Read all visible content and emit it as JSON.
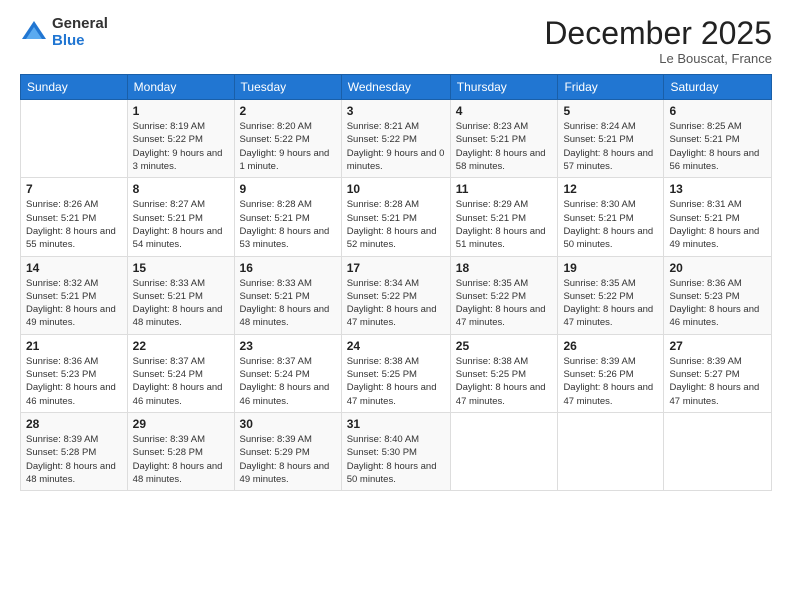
{
  "logo": {
    "general": "General",
    "blue": "Blue"
  },
  "title": "December 2025",
  "subtitle": "Le Bouscat, France",
  "days_of_week": [
    "Sunday",
    "Monday",
    "Tuesday",
    "Wednesday",
    "Thursday",
    "Friday",
    "Saturday"
  ],
  "weeks": [
    [
      {
        "day": "",
        "sunrise": "",
        "sunset": "",
        "daylight": ""
      },
      {
        "day": "1",
        "sunrise": "Sunrise: 8:19 AM",
        "sunset": "Sunset: 5:22 PM",
        "daylight": "Daylight: 9 hours and 3 minutes."
      },
      {
        "day": "2",
        "sunrise": "Sunrise: 8:20 AM",
        "sunset": "Sunset: 5:22 PM",
        "daylight": "Daylight: 9 hours and 1 minute."
      },
      {
        "day": "3",
        "sunrise": "Sunrise: 8:21 AM",
        "sunset": "Sunset: 5:22 PM",
        "daylight": "Daylight: 9 hours and 0 minutes."
      },
      {
        "day": "4",
        "sunrise": "Sunrise: 8:23 AM",
        "sunset": "Sunset: 5:21 PM",
        "daylight": "Daylight: 8 hours and 58 minutes."
      },
      {
        "day": "5",
        "sunrise": "Sunrise: 8:24 AM",
        "sunset": "Sunset: 5:21 PM",
        "daylight": "Daylight: 8 hours and 57 minutes."
      },
      {
        "day": "6",
        "sunrise": "Sunrise: 8:25 AM",
        "sunset": "Sunset: 5:21 PM",
        "daylight": "Daylight: 8 hours and 56 minutes."
      }
    ],
    [
      {
        "day": "7",
        "sunrise": "Sunrise: 8:26 AM",
        "sunset": "Sunset: 5:21 PM",
        "daylight": "Daylight: 8 hours and 55 minutes."
      },
      {
        "day": "8",
        "sunrise": "Sunrise: 8:27 AM",
        "sunset": "Sunset: 5:21 PM",
        "daylight": "Daylight: 8 hours and 54 minutes."
      },
      {
        "day": "9",
        "sunrise": "Sunrise: 8:28 AM",
        "sunset": "Sunset: 5:21 PM",
        "daylight": "Daylight: 8 hours and 53 minutes."
      },
      {
        "day": "10",
        "sunrise": "Sunrise: 8:28 AM",
        "sunset": "Sunset: 5:21 PM",
        "daylight": "Daylight: 8 hours and 52 minutes."
      },
      {
        "day": "11",
        "sunrise": "Sunrise: 8:29 AM",
        "sunset": "Sunset: 5:21 PM",
        "daylight": "Daylight: 8 hours and 51 minutes."
      },
      {
        "day": "12",
        "sunrise": "Sunrise: 8:30 AM",
        "sunset": "Sunset: 5:21 PM",
        "daylight": "Daylight: 8 hours and 50 minutes."
      },
      {
        "day": "13",
        "sunrise": "Sunrise: 8:31 AM",
        "sunset": "Sunset: 5:21 PM",
        "daylight": "Daylight: 8 hours and 49 minutes."
      }
    ],
    [
      {
        "day": "14",
        "sunrise": "Sunrise: 8:32 AM",
        "sunset": "Sunset: 5:21 PM",
        "daylight": "Daylight: 8 hours and 49 minutes."
      },
      {
        "day": "15",
        "sunrise": "Sunrise: 8:33 AM",
        "sunset": "Sunset: 5:21 PM",
        "daylight": "Daylight: 8 hours and 48 minutes."
      },
      {
        "day": "16",
        "sunrise": "Sunrise: 8:33 AM",
        "sunset": "Sunset: 5:21 PM",
        "daylight": "Daylight: 8 hours and 48 minutes."
      },
      {
        "day": "17",
        "sunrise": "Sunrise: 8:34 AM",
        "sunset": "Sunset: 5:22 PM",
        "daylight": "Daylight: 8 hours and 47 minutes."
      },
      {
        "day": "18",
        "sunrise": "Sunrise: 8:35 AM",
        "sunset": "Sunset: 5:22 PM",
        "daylight": "Daylight: 8 hours and 47 minutes."
      },
      {
        "day": "19",
        "sunrise": "Sunrise: 8:35 AM",
        "sunset": "Sunset: 5:22 PM",
        "daylight": "Daylight: 8 hours and 47 minutes."
      },
      {
        "day": "20",
        "sunrise": "Sunrise: 8:36 AM",
        "sunset": "Sunset: 5:23 PM",
        "daylight": "Daylight: 8 hours and 46 minutes."
      }
    ],
    [
      {
        "day": "21",
        "sunrise": "Sunrise: 8:36 AM",
        "sunset": "Sunset: 5:23 PM",
        "daylight": "Daylight: 8 hours and 46 minutes."
      },
      {
        "day": "22",
        "sunrise": "Sunrise: 8:37 AM",
        "sunset": "Sunset: 5:24 PM",
        "daylight": "Daylight: 8 hours and 46 minutes."
      },
      {
        "day": "23",
        "sunrise": "Sunrise: 8:37 AM",
        "sunset": "Sunset: 5:24 PM",
        "daylight": "Daylight: 8 hours and 46 minutes."
      },
      {
        "day": "24",
        "sunrise": "Sunrise: 8:38 AM",
        "sunset": "Sunset: 5:25 PM",
        "daylight": "Daylight: 8 hours and 47 minutes."
      },
      {
        "day": "25",
        "sunrise": "Sunrise: 8:38 AM",
        "sunset": "Sunset: 5:25 PM",
        "daylight": "Daylight: 8 hours and 47 minutes."
      },
      {
        "day": "26",
        "sunrise": "Sunrise: 8:39 AM",
        "sunset": "Sunset: 5:26 PM",
        "daylight": "Daylight: 8 hours and 47 minutes."
      },
      {
        "day": "27",
        "sunrise": "Sunrise: 8:39 AM",
        "sunset": "Sunset: 5:27 PM",
        "daylight": "Daylight: 8 hours and 47 minutes."
      }
    ],
    [
      {
        "day": "28",
        "sunrise": "Sunrise: 8:39 AM",
        "sunset": "Sunset: 5:28 PM",
        "daylight": "Daylight: 8 hours and 48 minutes."
      },
      {
        "day": "29",
        "sunrise": "Sunrise: 8:39 AM",
        "sunset": "Sunset: 5:28 PM",
        "daylight": "Daylight: 8 hours and 48 minutes."
      },
      {
        "day": "30",
        "sunrise": "Sunrise: 8:39 AM",
        "sunset": "Sunset: 5:29 PM",
        "daylight": "Daylight: 8 hours and 49 minutes."
      },
      {
        "day": "31",
        "sunrise": "Sunrise: 8:40 AM",
        "sunset": "Sunset: 5:30 PM",
        "daylight": "Daylight: 8 hours and 50 minutes."
      },
      {
        "day": "",
        "sunrise": "",
        "sunset": "",
        "daylight": ""
      },
      {
        "day": "",
        "sunrise": "",
        "sunset": "",
        "daylight": ""
      },
      {
        "day": "",
        "sunrise": "",
        "sunset": "",
        "daylight": ""
      }
    ]
  ]
}
